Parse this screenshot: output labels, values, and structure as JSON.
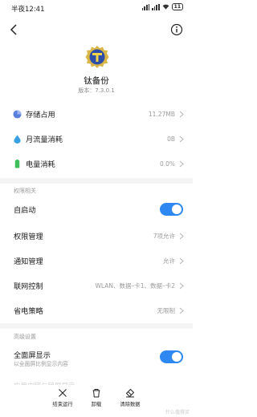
{
  "status_bar": {
    "time": "半夜12:41",
    "battery": "11"
  },
  "app": {
    "name": "钛备份",
    "version": "版本：7.3.0.1"
  },
  "usage": [
    {
      "label": "存储占用",
      "value": "11.27MB",
      "icon": "pie-chart-icon",
      "color": "#5b7fdd"
    },
    {
      "label": "月流量消耗",
      "value": "0B",
      "icon": "water-drop-icon",
      "color": "#3aa0e6"
    },
    {
      "label": "电量消耗",
      "value": "0.0%",
      "icon": "battery-icon",
      "color": "#3fbf5a"
    }
  ],
  "permissions": {
    "section_title": "权限相关",
    "autostart": {
      "label": "自启动",
      "on": true
    },
    "items": [
      {
        "label": "权限管理",
        "value": "7项允许"
      },
      {
        "label": "通知管理",
        "value": "允许"
      },
      {
        "label": "联网控制",
        "value": "WLAN、数据–卡1、数据–卡2"
      },
      {
        "label": "省电策略",
        "value": "无限制"
      }
    ]
  },
  "advanced": {
    "section_title": "高级设置",
    "fullscreen": {
      "label": "全面屏显示",
      "sub": "以全面屏比例显示内容",
      "on": true
    },
    "partial_label": "应用内网与锁屏显示"
  },
  "bottom_bar": {
    "stop": "结束运行",
    "uninstall": "卸载",
    "clear": "清除数据"
  },
  "watermark": "什么值得买",
  "accent": "#2f87f2"
}
